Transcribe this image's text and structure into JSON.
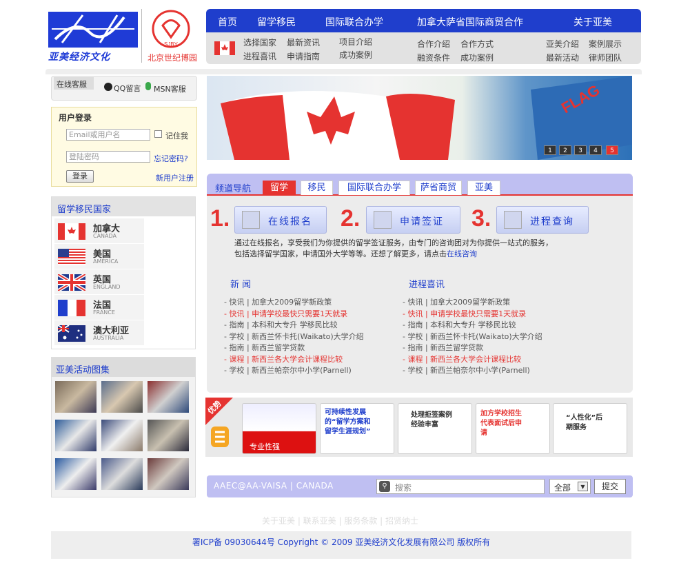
{
  "logo": {
    "brand_text": "亚美经济文化",
    "partner_text": "北京世纪博园",
    "partner_badge": "SJBY"
  },
  "nav": {
    "items": [
      "首页",
      "留学移民",
      "国际联合办学",
      "加拿大萨省国际商贸合作",
      "关于亚美"
    ]
  },
  "subnav": {
    "col1": [
      "选择国家",
      "进程喜讯"
    ],
    "col2": [
      "最新资讯",
      "申请指南"
    ],
    "col3": [
      "项目介绍",
      "成功案例"
    ],
    "col4": [
      "合作介绍",
      "融资条件"
    ],
    "col5": [
      "合作方式",
      "成功案例"
    ],
    "col6": [
      "亚美介绍",
      "最新活动"
    ],
    "col7": [
      "案例展示",
      "律师团队"
    ]
  },
  "kefu": {
    "title": "在线客服",
    "qq": "QQ留言",
    "msn": "MSN客服"
  },
  "login": {
    "title": "用户登录",
    "user_placeholder": "Email或用户名",
    "remember": "记住我",
    "pass_placeholder": "登陆密码",
    "forgot": "忘记密码?",
    "submit": "登录",
    "register": "新用户注册"
  },
  "countries": {
    "title": "留学移民国家",
    "items": [
      {
        "cn": "加拿大",
        "en": "CANADA"
      },
      {
        "cn": "美国",
        "en": "AMERICA"
      },
      {
        "cn": "英国",
        "en": "ENGLAND"
      },
      {
        "cn": "法国",
        "en": "FRANCE"
      },
      {
        "cn": "澳大利亚",
        "en": "AUSTRALIA"
      }
    ]
  },
  "gallery": {
    "title": "亚美活动图集"
  },
  "banner": {
    "pages": [
      "1",
      "2",
      "3",
      "4",
      "5"
    ],
    "active_page": "5"
  },
  "channel": {
    "label": "频道导航",
    "tabs": [
      "留学",
      "移民",
      "国际联合办学",
      "萨省商贸",
      "亚美"
    ],
    "active_tab": "留学"
  },
  "steps": [
    {
      "num": "1.",
      "label": "在线报名"
    },
    {
      "num": "2.",
      "label": "申请签证"
    },
    {
      "num": "3.",
      "label": "进程查询"
    }
  ],
  "intro": {
    "line1": "通过在线报名，享受我们为你提供的留学签证服务，由专门的咨询团对为你提供一站式的服务，",
    "line2": "包括选择留学国家，申请国外大学等等。还想了解更多，请点击",
    "link": "在线咨询"
  },
  "news_left": {
    "title": "新  闻",
    "items": [
      {
        "t": "- 快讯 | 加拿大2009留学新政策",
        "red": false
      },
      {
        "t": "- 快讯 | 申请学校最快只需要1天就录",
        "red": true
      },
      {
        "t": "- 指南 | 本科和大专升 学移民比较",
        "red": false
      },
      {
        "t": "- 学校 | 新西兰怀卡托(Waikato)大学介绍",
        "red": false
      },
      {
        "t": "- 指南 | 新西兰留学贷款",
        "red": false
      },
      {
        "t": "- 课程 | 新西兰各大学会计课程比较",
        "red": true
      },
      {
        "t": "- 学校 | 新西兰帕奈尔中小学(Parnell)",
        "red": false
      }
    ]
  },
  "news_right": {
    "title": "进程喜讯",
    "items": [
      {
        "t": "- 快讯 | 加拿大2009留学新政策",
        "red": false
      },
      {
        "t": "- 快讯 | 申请学校最快只需要1天就录",
        "red": true
      },
      {
        "t": "- 指南 | 本科和大专升 学移民比较",
        "red": false
      },
      {
        "t": "- 学校 | 新西兰怀卡托(Waikato)大学介绍",
        "red": false
      },
      {
        "t": "- 指南 | 新西兰留学贷款",
        "red": false
      },
      {
        "t": "- 课程 | 新西兰各大学会计课程比较",
        "red": true
      },
      {
        "t": "- 学校 | 新西兰帕奈尔中小学(Parnell)",
        "red": false
      }
    ]
  },
  "ads": {
    "badge": "优势",
    "items": [
      "专业性强",
      "可持续性发展的“留学方案和留学生涯规划”",
      "处理拒签案例经验丰富",
      "加方学校招生代表面试后申请",
      "“人性化”后期服务"
    ]
  },
  "search": {
    "brand": "AAEC@AA-VAISA | CANADA",
    "placeholder": "搜索",
    "scope": "全部",
    "submit": "提交"
  },
  "footer": {
    "links": "关于亚美 | 联系亚美 | 服务条款 | 招贤纳士",
    "copyright": "署ICP备 09030644号    Copyright © 2009  亚美经济文化发展有限公司 版权所有"
  },
  "colors": {
    "brand_blue": "#1f3ecc",
    "accent_red": "#e53330",
    "tab_lilac": "#bfbff2"
  }
}
